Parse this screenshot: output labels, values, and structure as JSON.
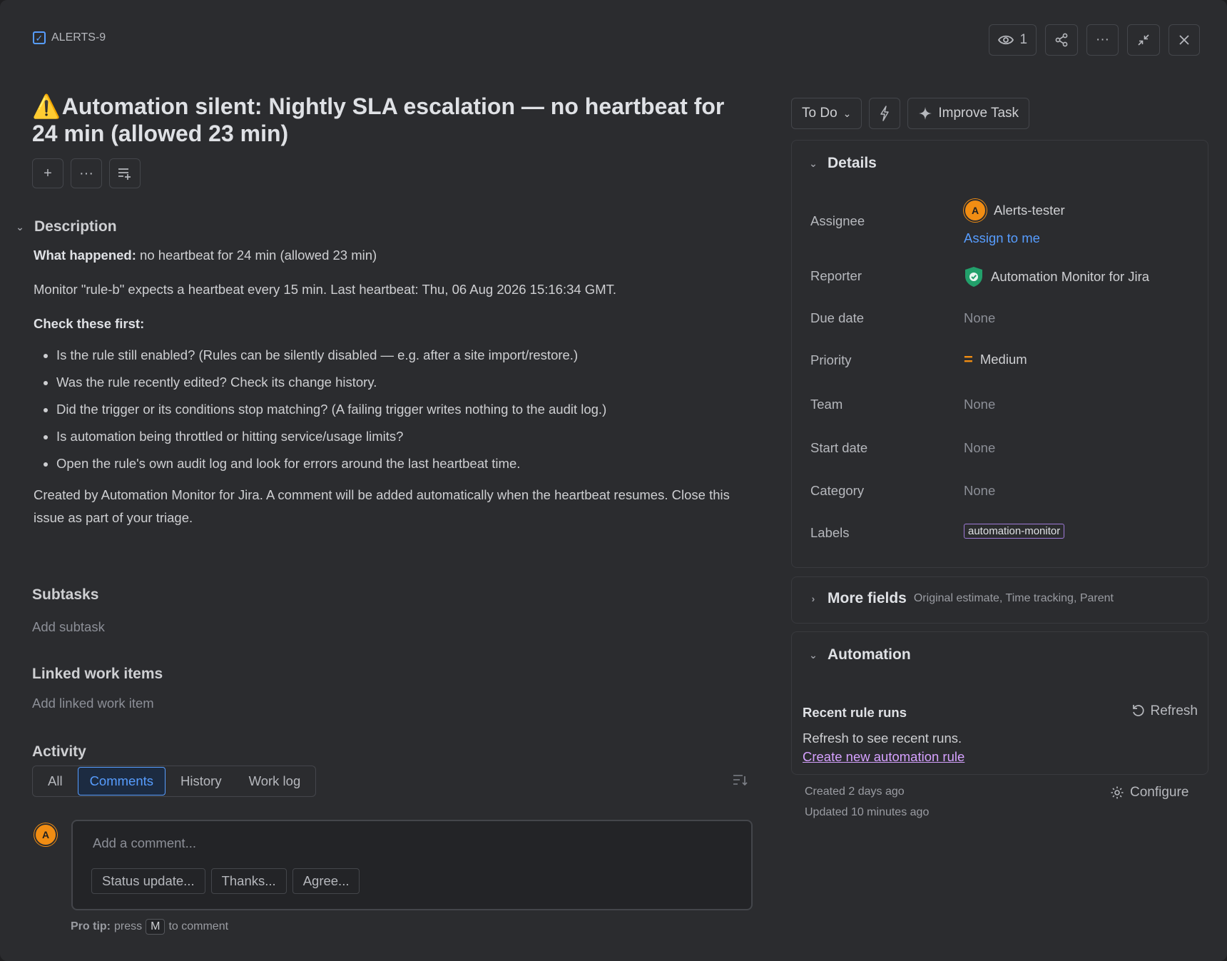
{
  "header": {
    "issue_key": "ALERTS-9",
    "watchers_count": "1"
  },
  "title": "Automation silent: Nightly SLA escalation — no heartbeat for 24 min (allowed 23 min)",
  "title_emoji": "⚠️",
  "description": {
    "heading": "Description",
    "what_happened_label": "What happened:",
    "what_happened_text": " no heartbeat for 24 min (allowed 23 min)",
    "monitor_text": "Monitor \"rule-b\" expects a heartbeat every 15 min. Last heartbeat: Thu, 06 Aug 2026 15:16:34 GMT.",
    "check_heading": "Check these first:",
    "checks": [
      "Is the rule still enabled? (Rules can be silently disabled — e.g. after a site import/restore.)",
      "Was the rule recently edited? Check its change history.",
      "Did the trigger or its conditions stop matching? (A failing trigger writes nothing to the audit log.)",
      "Is automation being throttled or hitting service/usage limits?",
      "Open the rule's own audit log and look for errors around the last heartbeat time."
    ],
    "closing": "Created by Automation Monitor for Jira. A comment will be added automatically when the heartbeat resumes. Close this issue as part of your triage."
  },
  "subtasks": {
    "heading": "Subtasks",
    "add": "Add subtask"
  },
  "linked": {
    "heading": "Linked work items",
    "add": "Add linked work item"
  },
  "activity": {
    "heading": "Activity",
    "tabs": [
      "All",
      "Comments",
      "History",
      "Work log"
    ],
    "active_tab": "Comments",
    "avatar_initial": "A",
    "comment_placeholder": "Add a comment...",
    "quick_replies": [
      "Status update...",
      "Thanks...",
      "Agree..."
    ],
    "protip_label": "Pro tip:",
    "protip_pre": "press",
    "protip_key": "M",
    "protip_post": "to comment"
  },
  "status": {
    "current": "To Do",
    "improve_label": "Improve Task"
  },
  "details": {
    "heading": "Details",
    "assignee_label": "Assignee",
    "assignee_initial": "A",
    "assignee_name": "Alerts-tester",
    "assign_to_me": "Assign to me",
    "reporter_label": "Reporter",
    "reporter_name": "Automation Monitor for Jira",
    "due_label": "Due date",
    "due_value": "None",
    "priority_label": "Priority",
    "priority_value": "Medium",
    "team_label": "Team",
    "team_value": "None",
    "start_label": "Start date",
    "start_value": "None",
    "category_label": "Category",
    "category_value": "None",
    "labels_label": "Labels",
    "labels_value": "automation-monitor"
  },
  "more_fields": {
    "heading": "More fields",
    "sub": "Original estimate, Time tracking, Parent"
  },
  "automation": {
    "heading": "Automation",
    "recent_runs": "Recent rule runs",
    "refresh": "Refresh",
    "refresh_hint": "Refresh to see recent runs.",
    "create_link": "Create new automation rule"
  },
  "meta": {
    "created": "Created 2 days ago",
    "updated": "Updated 10 minutes ago",
    "configure": "Configure"
  },
  "colors": {
    "background": "#2b2c2f",
    "accent_blue": "#579dff",
    "avatar_orange": "#f18d13",
    "reporter_green": "#22a06b",
    "link_purple": "#d6a1ff",
    "label_border": "#9f7ad8"
  }
}
